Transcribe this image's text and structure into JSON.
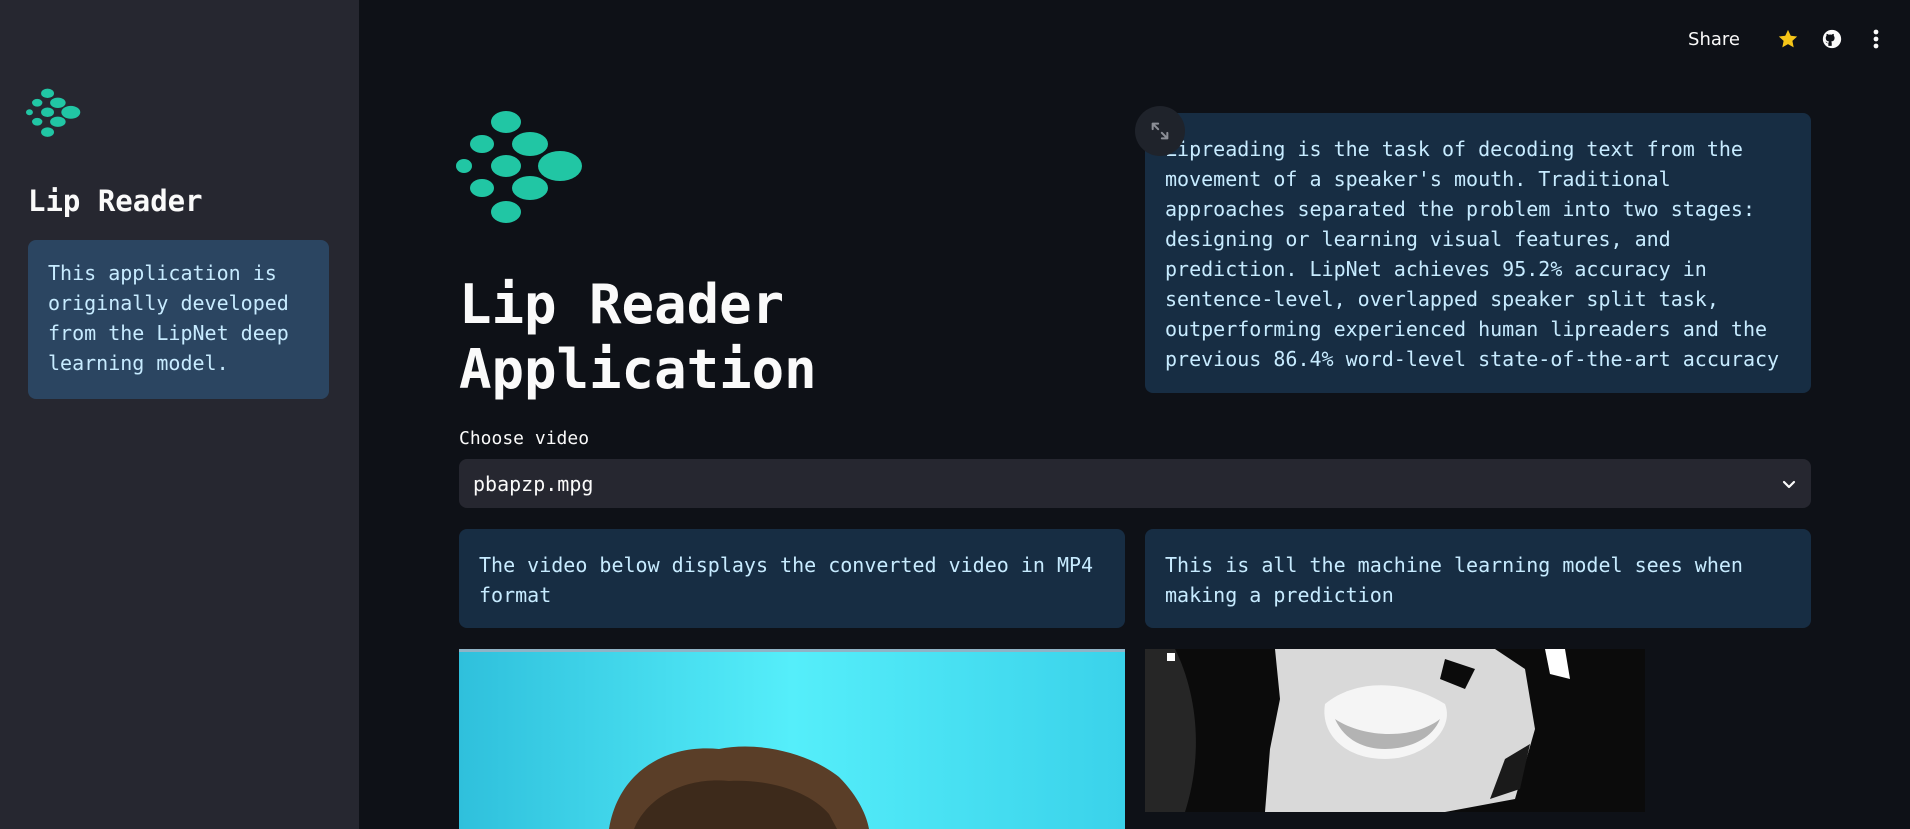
{
  "sidebar": {
    "title": "Lip Reader",
    "info": "This application is originally developed from the LipNet deep learning model."
  },
  "toolbar": {
    "share_label": "Share",
    "icons": [
      "star-icon",
      "github-icon",
      "more-vertical-icon"
    ]
  },
  "main": {
    "title_line1": "Lip Reader",
    "title_line2": "Application",
    "description": "Lipreading is the task of decoding text from the movement of a speaker's mouth. Traditional approaches separated the problem into two stages: designing or learning visual features, and prediction. LipNet achieves 95.2% accuracy in sentence-level, overlapped speaker split task, outperforming experienced human lipreaders and the previous 86.4% word-level state-of-the-art accuracy",
    "choose_label": "Choose video",
    "selected_video": "pbapzp.mpg",
    "left_info": "The video below displays the converted video in MP4 format",
    "right_info": "This is all the machine learning model sees when making a prediction"
  },
  "colors": {
    "background": "#0e1117",
    "sidebar": "#262730",
    "info_box": "#172d43",
    "logo": "#21c6a4",
    "star": "#f5c518"
  }
}
